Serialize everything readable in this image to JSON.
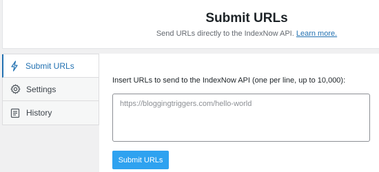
{
  "header": {
    "title": "Submit URLs",
    "subtitle": "Send URLs directly to the IndexNow API.",
    "learn_more": "Learn more."
  },
  "sidebar": {
    "items": [
      {
        "label": "Submit URLs",
        "icon": "bolt-icon",
        "active": true
      },
      {
        "label": "Settings",
        "icon": "gear-icon",
        "active": false
      },
      {
        "label": "History",
        "icon": "history-list-icon",
        "active": false
      }
    ]
  },
  "form": {
    "label": "Insert URLs to send to the IndexNow API (one per line, up to 10,000):",
    "placeholder": "https://bloggingtriggers.com/hello-world",
    "value": "",
    "submit_label": "Submit URLs"
  },
  "colors": {
    "accent": "#2271b1",
    "button": "#2ea2f0",
    "page_bg": "#f0f0f1"
  }
}
